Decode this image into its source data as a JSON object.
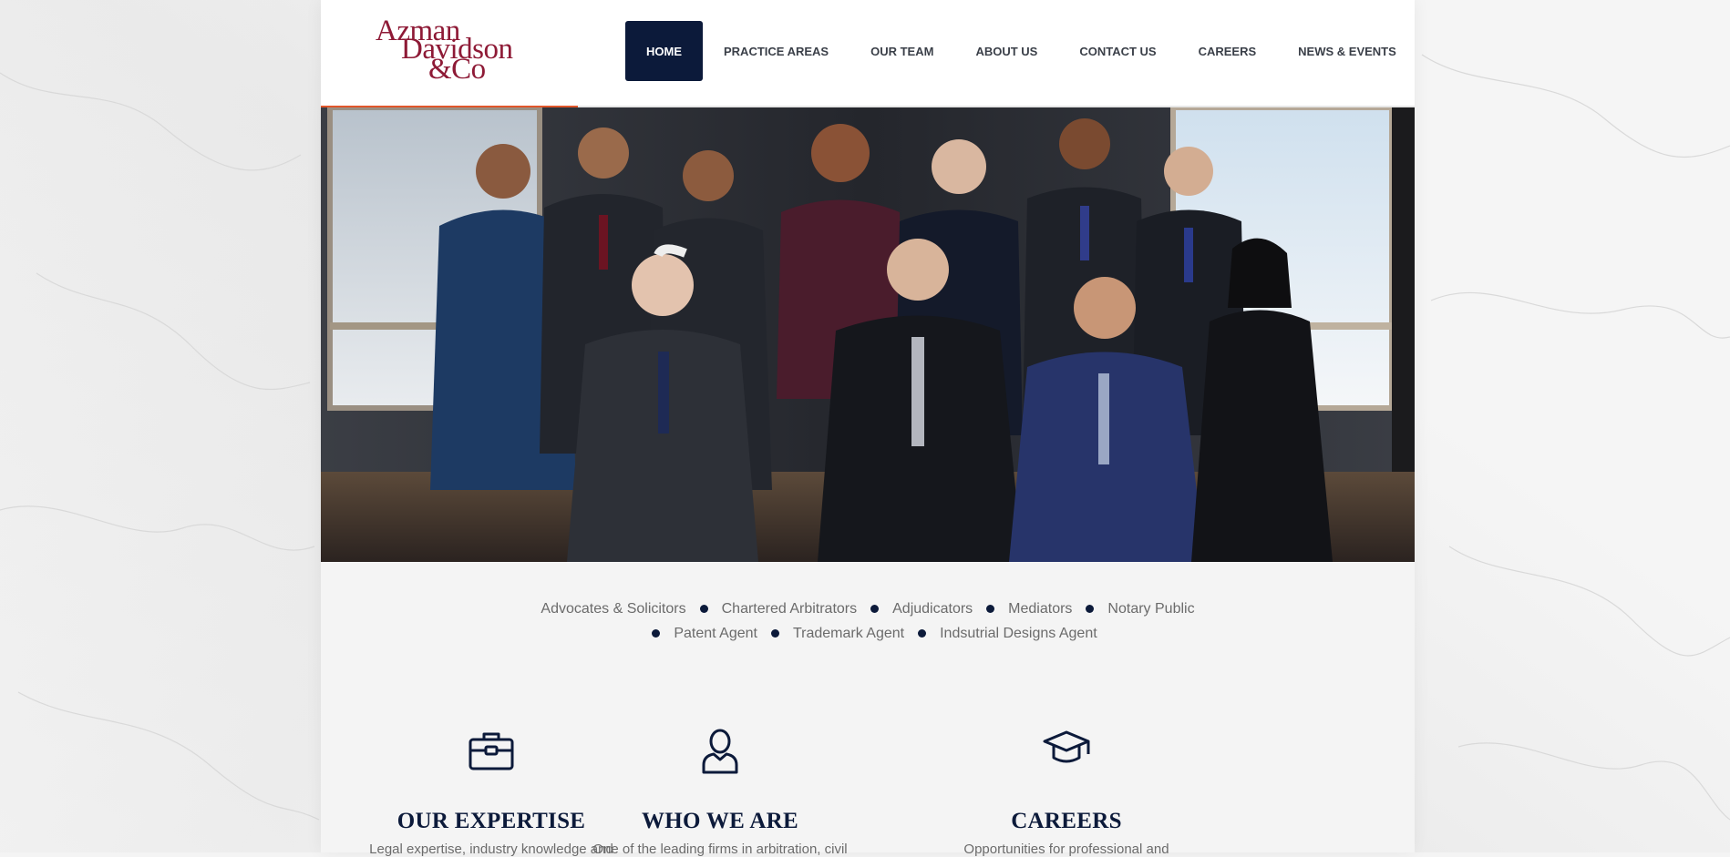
{
  "brand": {
    "logo_line1": "Azman",
    "logo_line2": "Davidson",
    "logo_line3": "&Co",
    "logo_color": "#8e1a36"
  },
  "nav": {
    "items": [
      {
        "label": "HOME",
        "active": true
      },
      {
        "label": "PRACTICE AREAS",
        "active": false
      },
      {
        "label": "OUR TEAM",
        "active": false
      },
      {
        "label": "ABOUT US",
        "active": false
      },
      {
        "label": "CONTACT US",
        "active": false
      },
      {
        "label": "CAREERS",
        "active": false
      },
      {
        "label": "NEWS & EVENTS",
        "active": false
      }
    ],
    "active_color": "#0c1a3a"
  },
  "slider": {
    "progress_fraction": 0.235,
    "progress_color": "#e0562a"
  },
  "services": {
    "row1": [
      "Advocates & Solicitors",
      "Chartered Arbitrators",
      "Adjudicators",
      "Mediators",
      "Notary Public"
    ],
    "row2": [
      "Patent Agent",
      "Trademark Agent",
      "Indsutrial Designs Agent"
    ]
  },
  "features": [
    {
      "icon": "briefcase-icon",
      "title": "OUR EXPERTISE",
      "text": "Legal expertise, industry knowledge and"
    },
    {
      "icon": "person-icon",
      "title": "WHO WE ARE",
      "text": "One of the leading firms in arbitration, civil"
    },
    {
      "icon": "graduation-cap-icon",
      "title": "CAREERS",
      "text": "Opportunities for professional and"
    }
  ],
  "colors": {
    "navy": "#0c1a3a",
    "accent": "#e0562a"
  }
}
